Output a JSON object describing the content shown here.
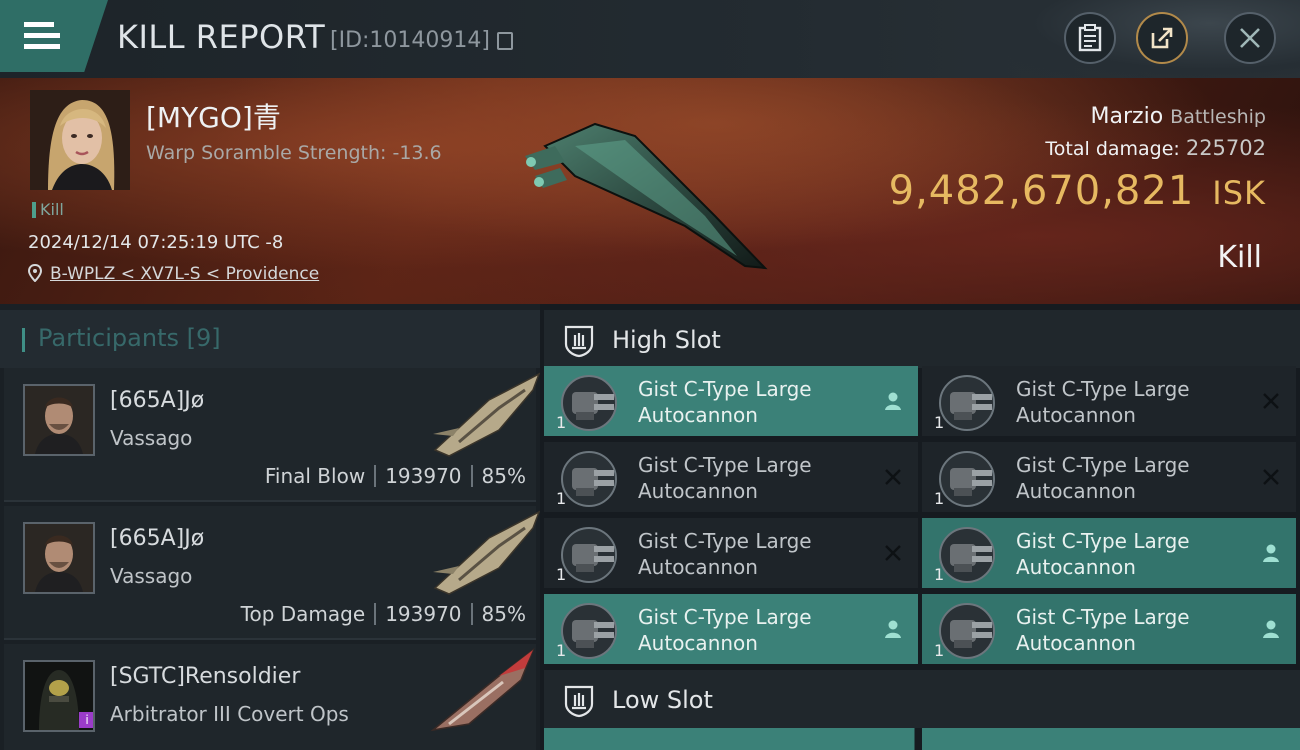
{
  "header": {
    "title": "KILL REPORT",
    "report_id": "[ID:10140914]",
    "icons": [
      "menu-icon",
      "copy-icon",
      "clipboard-icon",
      "share-icon",
      "close-icon"
    ]
  },
  "victim": {
    "name": "[MYGO]青",
    "subtitle": "Warp Soramble Strength: -13.6",
    "tag": "Kill",
    "datetime": "2024/12/14 07:25:19 UTC -8",
    "location": "B-WPLZ < XV7L-S < Providence",
    "ship_name": "Marzio",
    "ship_class": "Battleship",
    "total_damage_label": "Total damage:",
    "total_damage": "225702",
    "isk_value": "9,482,670,821",
    "isk_unit": "ISK",
    "result": "Kill"
  },
  "participants": {
    "header": "Participants [9]",
    "rows": [
      {
        "name": "[665A]Jø",
        "ship": "Vassago",
        "label": "Final Blow",
        "damage": "193970",
        "percent": "85%"
      },
      {
        "name": "[665A]Jø",
        "ship": "Vassago",
        "label": "Top Damage",
        "damage": "193970",
        "percent": "85%"
      },
      {
        "name": "[SGTC]Rensoldier",
        "ship": "Arbitrator III Covert Ops",
        "label": "",
        "damage": "",
        "percent": ""
      }
    ]
  },
  "slots": {
    "high_slot_label": "High Slot",
    "low_slot_label": "Low Slot",
    "modules": [
      {
        "name_line1": "Gist C-Type Large",
        "name_line2": "Autocannon",
        "qty": "1",
        "status": "dropped"
      },
      {
        "name_line1": "Gist C-Type Large",
        "name_line2": "Autocannon",
        "qty": "1",
        "status": "destroyed"
      },
      {
        "name_line1": "Gist C-Type Large",
        "name_line2": "Autocannon",
        "qty": "1",
        "status": "destroyed"
      },
      {
        "name_line1": "Gist C-Type Large",
        "name_line2": "Autocannon",
        "qty": "1",
        "status": "destroyed"
      },
      {
        "name_line1": "Gist C-Type Large",
        "name_line2": "Autocannon",
        "qty": "1",
        "status": "destroyed"
      },
      {
        "name_line1": "Gist C-Type Large",
        "name_line2": "Autocannon",
        "qty": "1",
        "status": "dropped"
      },
      {
        "name_line1": "Gist C-Type Large",
        "name_line2": "Autocannon",
        "qty": "1",
        "status": "dropped"
      },
      {
        "name_line1": "Gist C-Type Large",
        "name_line2": "Autocannon",
        "qty": "1",
        "status": "dropped"
      }
    ]
  },
  "colors": {
    "accent_teal": "#3b8178",
    "isk_gold": "#e6b961",
    "banner_red": "#5a2415"
  }
}
